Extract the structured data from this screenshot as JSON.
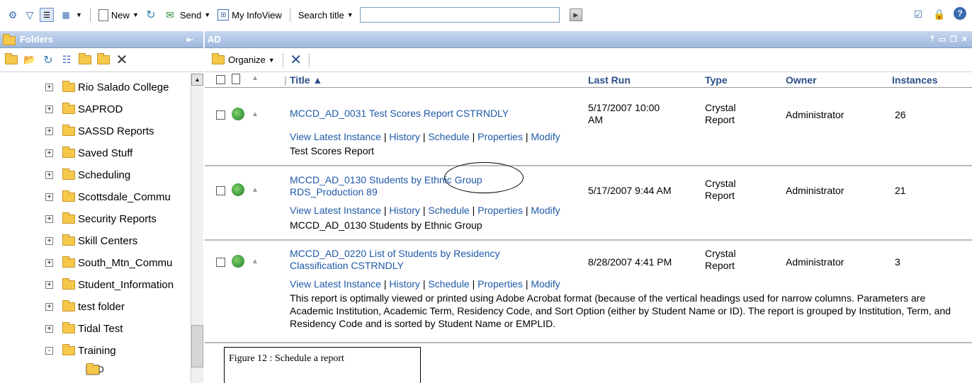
{
  "toolbar": {
    "new_label": "New",
    "send_label": "Send",
    "my_infoview_label": "My InfoView",
    "search_title_label": "Search title",
    "search_value": ""
  },
  "folders_panel": {
    "title": "Folders",
    "tree": [
      {
        "label": "Rio Salado College",
        "expander": "+"
      },
      {
        "label": "SAPROD",
        "expander": "+"
      },
      {
        "label": "SASSD Reports",
        "expander": "+"
      },
      {
        "label": "Saved Stuff",
        "expander": "+"
      },
      {
        "label": "Scheduling",
        "expander": "+"
      },
      {
        "label": "Scottsdale_Commu",
        "expander": "+"
      },
      {
        "label": "Security Reports",
        "expander": "+"
      },
      {
        "label": "Skill Centers",
        "expander": "+"
      },
      {
        "label": "South_Mtn_Commu",
        "expander": "+"
      },
      {
        "label": "Student_Information",
        "expander": "+"
      },
      {
        "label": "test folder",
        "expander": "+"
      },
      {
        "label": "Tidal Test",
        "expander": "+"
      },
      {
        "label": "Training",
        "expander": "-"
      }
    ],
    "subfolder_label": "AD"
  },
  "content_panel": {
    "title": "AD",
    "organize_label": "Organize",
    "columns": {
      "title": "Title ▲",
      "last_run": "Last Run",
      "type": "Type",
      "owner": "Owner",
      "instances": "Instances"
    },
    "action_labels": [
      "View Latest Instance",
      "History",
      "Schedule",
      "Properties",
      "Modify"
    ],
    "rows": [
      {
        "title_line1": "MCCD_AD_0031 Test Scores Report CSTRNDLY",
        "title_line2": "",
        "last_run_line1": "5/17/2007 10:00",
        "last_run_line2": "AM",
        "type_line1": "Crystal",
        "type_line2": "Report",
        "owner": "Administrator",
        "instances": "26",
        "description": "Test Scores Report"
      },
      {
        "title_line1": "MCCD_AD_0130 Students by Ethnic Group",
        "title_line2": "RDS_Production 89",
        "last_run_line1": "5/17/2007 9:44 AM",
        "last_run_line2": "",
        "type_line1": "Crystal",
        "type_line2": "Report",
        "owner": "Administrator",
        "instances": "21",
        "description": "MCCD_AD_0130 Students by Ethnic Group"
      },
      {
        "title_line1": "MCCD_AD_0220 List of Students by Residency",
        "title_line2": "Classification CSTRNDLY",
        "last_run_line1": "8/28/2007 4:41 PM",
        "last_run_line2": "",
        "type_line1": "Crystal",
        "type_line2": "Report",
        "owner": "Administrator",
        "instances": "3",
        "description": "This report is optimally viewed or printed using Adobe Acrobat format (because of the vertical headings used for narrow columns. Parameters are Academic Institution, Academic Term, Residency Code, and Sort Option (either by Student Name or ID). The report is grouped by Institution, Term, and Residency Code and is sorted by Student Name or EMPLID."
      }
    ]
  },
  "caption": "Figure 12 : Schedule a report"
}
